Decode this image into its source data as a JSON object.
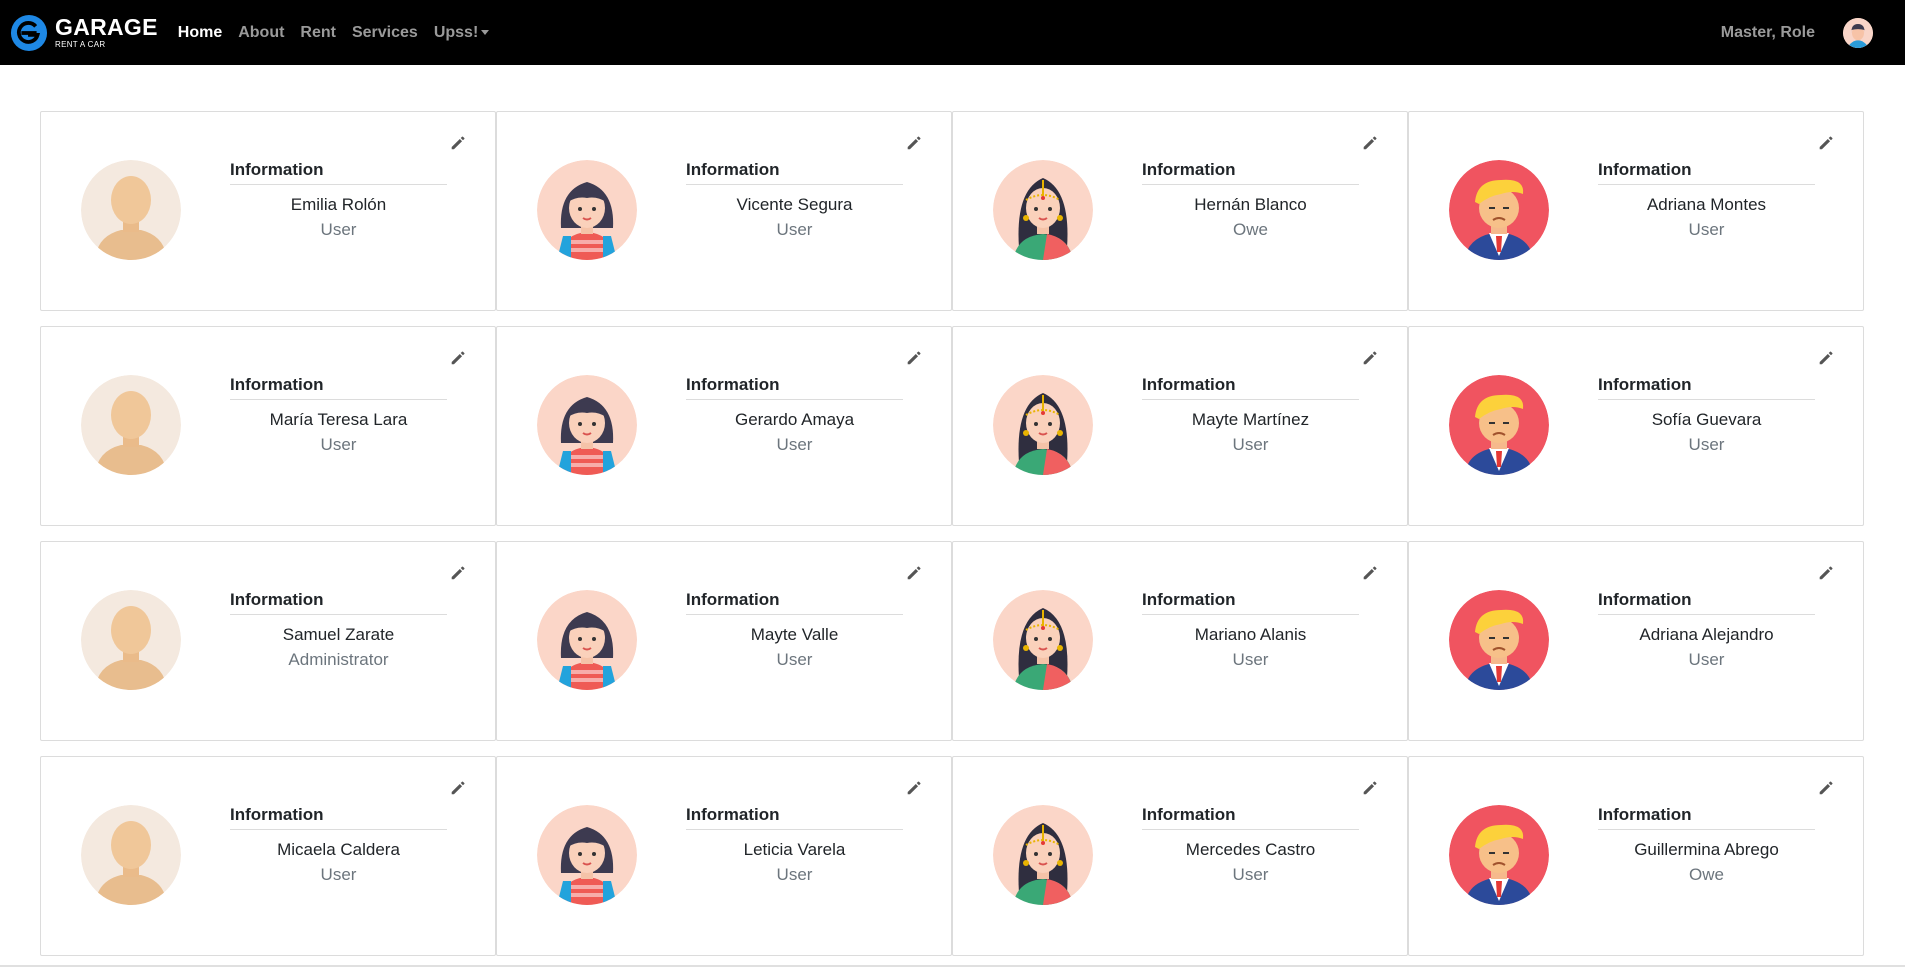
{
  "brand": {
    "name": "GARAGE",
    "tagline": "RENT A CAR",
    "icon": "garage-logo-icon"
  },
  "nav": {
    "links": [
      {
        "label": "Home",
        "active": true
      },
      {
        "label": "About",
        "active": false
      },
      {
        "label": "Rent",
        "active": false
      },
      {
        "label": "Services",
        "active": false
      },
      {
        "label": "Upss!",
        "active": false,
        "dropdown": true
      }
    ],
    "user": {
      "name": "Master, Role",
      "avatar": "user-avatar-icon"
    }
  },
  "colors": {
    "navbar": "#000000",
    "brand_accent": "#1e88e5",
    "muted_text": "#6c757d",
    "card_border": "#dcdcdc"
  },
  "cards": [
    {
      "title": "Information",
      "name": "Emilia Rolón",
      "role": "User",
      "avatar": "default"
    },
    {
      "title": "Information",
      "name": "Vicente Segura",
      "role": "User",
      "avatar": "girl"
    },
    {
      "title": "Information",
      "name": "Hernán Blanco",
      "role": "Owe",
      "avatar": "indian"
    },
    {
      "title": "Information",
      "name": "Adriana Montes",
      "role": "User",
      "avatar": "man"
    },
    {
      "title": "Information",
      "name": "María Teresa Lara",
      "role": "User",
      "avatar": "default"
    },
    {
      "title": "Information",
      "name": "Gerardo Amaya",
      "role": "User",
      "avatar": "girl"
    },
    {
      "title": "Information",
      "name": "Mayte Martínez",
      "role": "User",
      "avatar": "indian"
    },
    {
      "title": "Information",
      "name": "Sofía Guevara",
      "role": "User",
      "avatar": "man"
    },
    {
      "title": "Information",
      "name": "Samuel Zarate",
      "role": "Administrator",
      "avatar": "default"
    },
    {
      "title": "Information",
      "name": "Mayte Valle",
      "role": "User",
      "avatar": "girl"
    },
    {
      "title": "Information",
      "name": "Mariano Alanis",
      "role": "User",
      "avatar": "indian"
    },
    {
      "title": "Information",
      "name": "Adriana Alejandro",
      "role": "User",
      "avatar": "man"
    },
    {
      "title": "Information",
      "name": "Micaela Caldera",
      "role": "User",
      "avatar": "default"
    },
    {
      "title": "Information",
      "name": "Leticia Varela",
      "role": "User",
      "avatar": "girl"
    },
    {
      "title": "Information",
      "name": "Mercedes Castro",
      "role": "User",
      "avatar": "indian"
    },
    {
      "title": "Information",
      "name": "Guillermina Abrego",
      "role": "Owe",
      "avatar": "man"
    }
  ]
}
